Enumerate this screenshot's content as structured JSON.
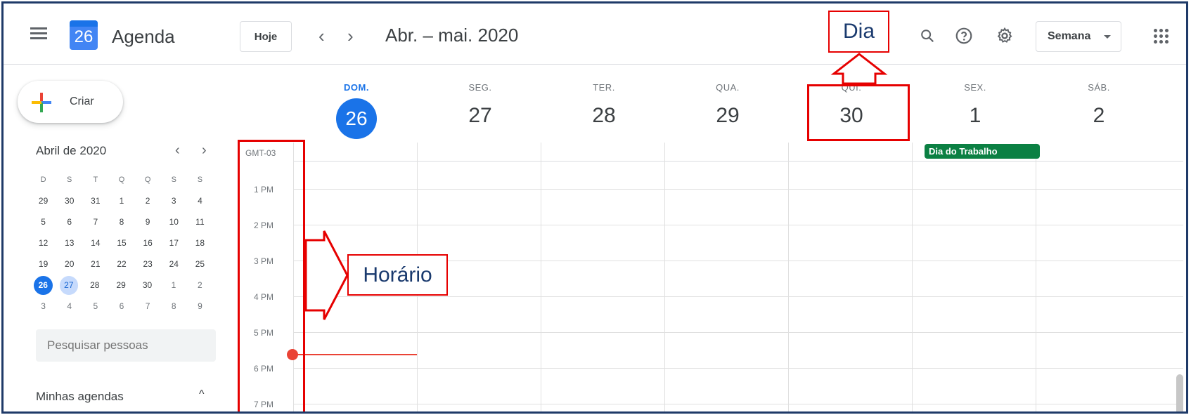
{
  "header": {
    "menu_icon": "hamburger-menu-icon",
    "logo_day": "26",
    "app_title": "Agenda",
    "today_button": "Hoje",
    "prev_icon": "‹",
    "next_icon": "›",
    "date_range": "Abr. – mai. 2020",
    "search_icon": "search-icon",
    "help_icon": "help-icon",
    "settings_icon": "gear-icon",
    "view_label": "Semana",
    "apps_icon": "apps-grid-icon"
  },
  "sidebar": {
    "create_label": "Criar",
    "mini_calendar": {
      "title": "Abril de 2020",
      "prev": "‹",
      "next": "›",
      "weekday_headers": [
        "D",
        "S",
        "T",
        "Q",
        "Q",
        "S",
        "S"
      ],
      "weeks": [
        [
          "29",
          "30",
          "31",
          "1",
          "2",
          "3",
          "4"
        ],
        [
          "5",
          "6",
          "7",
          "8",
          "9",
          "10",
          "11"
        ],
        [
          "12",
          "13",
          "14",
          "15",
          "16",
          "17",
          "18"
        ],
        [
          "19",
          "20",
          "21",
          "22",
          "23",
          "24",
          "25"
        ],
        [
          "26",
          "27",
          "28",
          "29",
          "30",
          "1",
          "2"
        ],
        [
          "3",
          "4",
          "5",
          "6",
          "7",
          "8",
          "9"
        ]
      ],
      "today": "26",
      "selected": "27"
    },
    "search_placeholder": "Pesquisar pessoas",
    "my_calendars_label": "Minhas agendas",
    "my_calendars_toggle": "^"
  },
  "week": {
    "days": [
      {
        "name": "DOM.",
        "num": "26",
        "today": true
      },
      {
        "name": "SEG.",
        "num": "27"
      },
      {
        "name": "TER.",
        "num": "28"
      },
      {
        "name": "QUA.",
        "num": "29"
      },
      {
        "name": "QUI.",
        "num": "30"
      },
      {
        "name": "SEX.",
        "num": "1"
      },
      {
        "name": "SÁB.",
        "num": "2"
      }
    ],
    "timezone": "GMT-03",
    "hours": [
      "1 PM",
      "2 PM",
      "3 PM",
      "4 PM",
      "5 PM",
      "6 PM",
      "7 PM"
    ],
    "all_day_event": "Dia do Trabalho",
    "event_color": "#0b8043"
  },
  "annotations": {
    "day_callout": "Dia",
    "hour_callout": "Horário",
    "color": "#e60000"
  },
  "colors": {
    "accent": "#1a73e8",
    "now_indicator": "#ea4335"
  }
}
